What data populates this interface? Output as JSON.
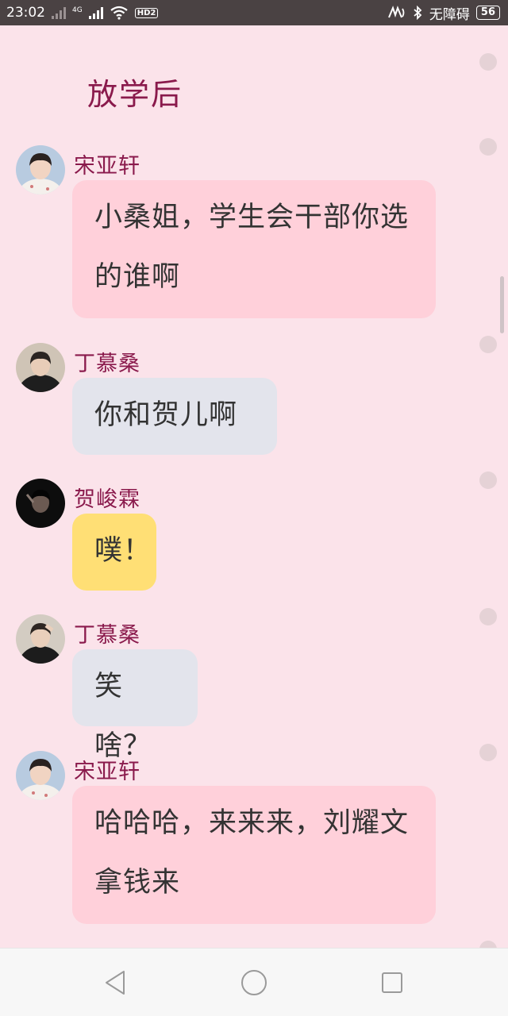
{
  "status_bar": {
    "time": "23:02",
    "network_tag": "4G",
    "hd_label": "HD2",
    "accessibility": "无障碍",
    "battery": "56"
  },
  "scene_title": "放学后",
  "messages": [
    {
      "sender": "宋亚轩",
      "text": "小桑姐，学生会干部你选的谁啊",
      "bubble_color": "#ffd0da"
    },
    {
      "sender": "丁慕桑",
      "text": "你和贺儿啊",
      "bubble_color": "#e3e4ec"
    },
    {
      "sender": "贺峻霖",
      "text": "噗！",
      "bubble_color": "#ffdf75"
    },
    {
      "sender": "丁慕桑",
      "text": "笑啥？",
      "bubble_color": "#e3e4ec"
    },
    {
      "sender": "宋亚轩",
      "text": "哈哈哈，来来来，刘耀文拿钱来",
      "bubble_color": "#ffd0da"
    }
  ],
  "nav_bar": {
    "back": "back-icon",
    "home": "home-icon",
    "recents": "recents-icon"
  },
  "colors": {
    "background": "#fbe3ea",
    "accent": "#8a1a4c",
    "status_bar": "#4a4243"
  }
}
